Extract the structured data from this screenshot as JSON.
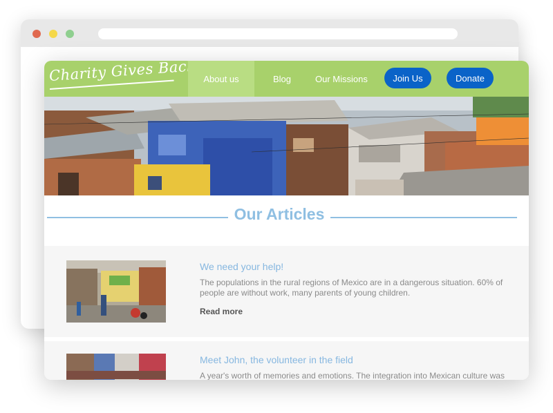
{
  "site": {
    "logo_text": "Charity Gives Back",
    "nav": {
      "about": "About us",
      "blog": "Blog",
      "missions": "Our Missions"
    },
    "buttons": {
      "join": "Join Us",
      "donate": "Donate"
    }
  },
  "articles_section": {
    "title": "Our Articles",
    "items": [
      {
        "title": "We need your help!",
        "excerpt": "The populations in the rural regions of Mexico are in a dangerous situation. 60% of people are without work, many parents of young children.",
        "read_more": "Read more"
      },
      {
        "title": "Meet John, the volunteer in the field",
        "excerpt": "A year's worth of memories and emotions. The integration into Mexican culture was"
      }
    ]
  },
  "colors": {
    "navbar": "#a8d16b",
    "button": "#0a63c8",
    "heading": "#8fbfe2"
  }
}
